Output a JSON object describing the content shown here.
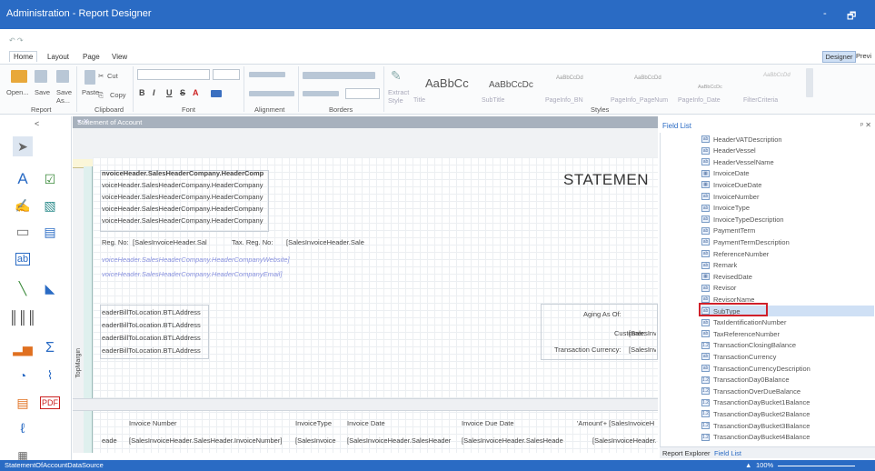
{
  "window": {
    "title": "Administration - Report Designer",
    "minimize": "-",
    "restore": "🗗"
  },
  "menu": {
    "home": "Home",
    "layout": "Layout",
    "page": "Page",
    "view": "View",
    "designer": "Designer",
    "preview": "Previ"
  },
  "ribbon": {
    "open": "Open...",
    "save": "Save",
    "saveas": "Save As...",
    "paste": "Paste",
    "cut": "Cut",
    "copy": "Copy",
    "groups": {
      "report": "Report",
      "clipboard": "Clipboard",
      "font": "Font",
      "alignment": "Alignment",
      "borders": "Borders",
      "styles": "Styles"
    },
    "font_buttons": {
      "b": "B",
      "i": "I",
      "u": "U",
      "s": "S",
      "a": "A"
    },
    "extract_style": "Extract Style",
    "styles": [
      {
        "preview": "AaBbCc",
        "name": "Title"
      },
      {
        "preview": "AaBbCcDc",
        "name": "SubTitle"
      },
      {
        "preview": "AaBbCcDd",
        "name": "PageInfo_BN"
      },
      {
        "preview": "AaBbCcDd",
        "name": "PageInfo_PageNum"
      },
      {
        "preview": "AaBbCcDc",
        "name": "PageInfo_Date"
      },
      {
        "preview": "AaBbCcDd",
        "name": "FilterCriteria"
      }
    ]
  },
  "nav": {
    "back": "<"
  },
  "document": {
    "tab": "Statement of Account",
    "close": "▾ ✕"
  },
  "canvas": {
    "company_lines": [
      "nvoiceHeader.SalesHeaderCompany.HeaderComp",
      "voiceHeader.SalesHeaderCompany.HeaderCompany",
      "voiceHeader.SalesHeaderCompany.HeaderCompany",
      "voiceHeader.SalesHeaderCompany.HeaderCompany",
      "voiceHeader.SalesHeaderCompany.HeaderCompany"
    ],
    "reg_no_label": "Reg. No:",
    "reg_no_value": "[SalesInvoiceHeader.Sal",
    "tax_reg_label": "Tax. Reg. No:",
    "tax_reg_value": "[SalesInvoiceHeader.Sale",
    "website": "voiceHeader.SalesHeaderCompany.HeaderCompanyWebsite]",
    "email": "voiceHeader.SalesHeaderCompany.HeaderCompanyEmail]",
    "statement_title": "STATEMEN",
    "bill_lines": [
      "eaderBillToLocation.BTLAddress",
      "eaderBillToLocation.BTLAddress",
      "eaderBillToLocation.BTLAddress",
      "eaderBillToLocation.BTLAddress"
    ],
    "aging_label": "Aging As Of:",
    "customer_label": "Customer:",
    "customer_value": "[SalesInv",
    "currency_label": "Transaction Currency:",
    "currency_value": "[SalesInv",
    "top_margin": "TopMargin",
    "headers": [
      "Invoice Number",
      "InvoiceType",
      "Invoice Date",
      "Invoice Due Date",
      "'Amount'+ [SalesInvoiceH"
    ],
    "detail": [
      "eade",
      "[SalesInvoiceHeader.SalesHeader.InvoiceNumber]",
      "[SalesInvoice",
      "[SalesInvoiceHeader.SalesHeader",
      "[SalesInvoiceHeader.SalesHeade",
      "[SalesInvoiceHeader."
    ]
  },
  "field_list": {
    "title": "Field List",
    "pin": "ᵖ ✕",
    "items": [
      {
        "name": "HeaderVATDescription",
        "type": "ab"
      },
      {
        "name": "HeaderVessel",
        "type": "ab"
      },
      {
        "name": "HeaderVesselName",
        "type": "ab"
      },
      {
        "name": "InvoiceDate",
        "type": "▦"
      },
      {
        "name": "InvoiceDueDate",
        "type": "▦"
      },
      {
        "name": "InvoiceNumber",
        "type": "ab"
      },
      {
        "name": "InvoiceType",
        "type": "ab"
      },
      {
        "name": "InvoiceTypeDescription",
        "type": "ab"
      },
      {
        "name": "PaymentTerm",
        "type": "ab"
      },
      {
        "name": "PaymentTermDescription",
        "type": "ab"
      },
      {
        "name": "ReferenceNumber",
        "type": "ab"
      },
      {
        "name": "Remark",
        "type": "ab"
      },
      {
        "name": "RevisedDate",
        "type": "▦"
      },
      {
        "name": "Revisor",
        "type": "ab"
      },
      {
        "name": "RevisorName",
        "type": "ab"
      },
      {
        "name": "SubType",
        "type": "ab"
      },
      {
        "name": "TaxIdentificationNumber",
        "type": "ab"
      },
      {
        "name": "TaxReferenceNumber",
        "type": "ab"
      },
      {
        "name": "TransactionClosingBalance",
        "type": "1.2"
      },
      {
        "name": "TransactionCurrency",
        "type": "ab"
      },
      {
        "name": "TransactionCurrencyDescription",
        "type": "ab"
      },
      {
        "name": "TransactionDay0Balance",
        "type": "1.2"
      },
      {
        "name": "TransactionOverDueBalance",
        "type": "1.2"
      },
      {
        "name": "TrasanctionDayBucket1Balance",
        "type": "1.2"
      },
      {
        "name": "TrasanctionDayBucket2Balance",
        "type": "1.2"
      },
      {
        "name": "TrasanctionDayBucket3Balance",
        "type": "1.2"
      },
      {
        "name": "TrasanctionDayBucket4Balance",
        "type": "1.2"
      }
    ],
    "selected": "SubType"
  },
  "bottom_tabs": {
    "report_explorer": "Report Explorer",
    "field_list": "Field List"
  },
  "status": {
    "datasource": "StatementOfAccountDataSource",
    "zoom": "100%"
  },
  "colors": {
    "title_bar": "#2a6bc4",
    "highlight": "#d0202a",
    "selection": "#cfe0f5"
  }
}
